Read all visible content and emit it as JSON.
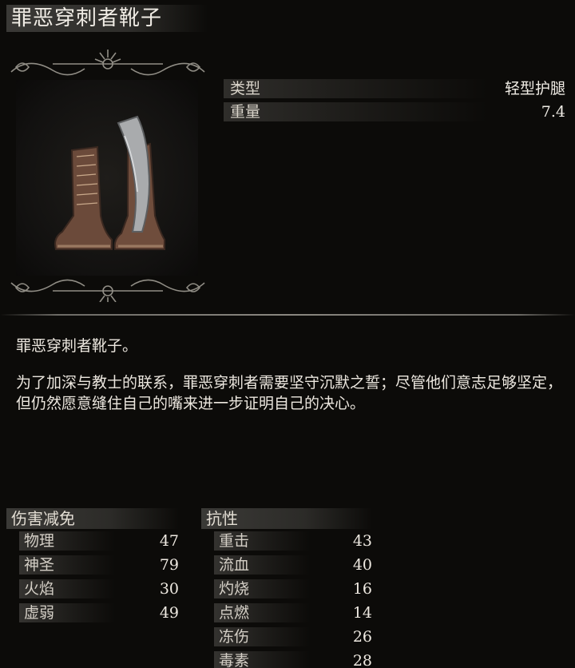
{
  "item": {
    "name": "罪恶穿刺者靴子",
    "type_label": "类型",
    "type_value": "轻型护腿",
    "weight_label": "重量",
    "weight_value": "7.4"
  },
  "description": {
    "line1": "罪恶穿刺者靴子。",
    "line2": "为了加深与教士的联系，罪恶穿刺者需要坚守沉默之誓；尽管他们意志足够坚定，但仍然愿意缝住自己的嘴来进一步证明自己的决心。"
  },
  "damage_negation": {
    "header": "伤害减免",
    "rows": [
      {
        "label": "物理",
        "value": "47"
      },
      {
        "label": "神圣",
        "value": "79"
      },
      {
        "label": "火焰",
        "value": "30"
      },
      {
        "label": "虚弱",
        "value": "49"
      }
    ]
  },
  "resistance": {
    "header": "抗性",
    "rows": [
      {
        "label": "重击",
        "value": "43"
      },
      {
        "label": "流血",
        "value": "40"
      },
      {
        "label": "灼烧",
        "value": "16"
      },
      {
        "label": "点燃",
        "value": "14"
      },
      {
        "label": "冻伤",
        "value": "26"
      },
      {
        "label": "毒素",
        "value": "28"
      }
    ]
  },
  "colors": {
    "background": "#0c0b09",
    "text": "#e6e1d8"
  }
}
